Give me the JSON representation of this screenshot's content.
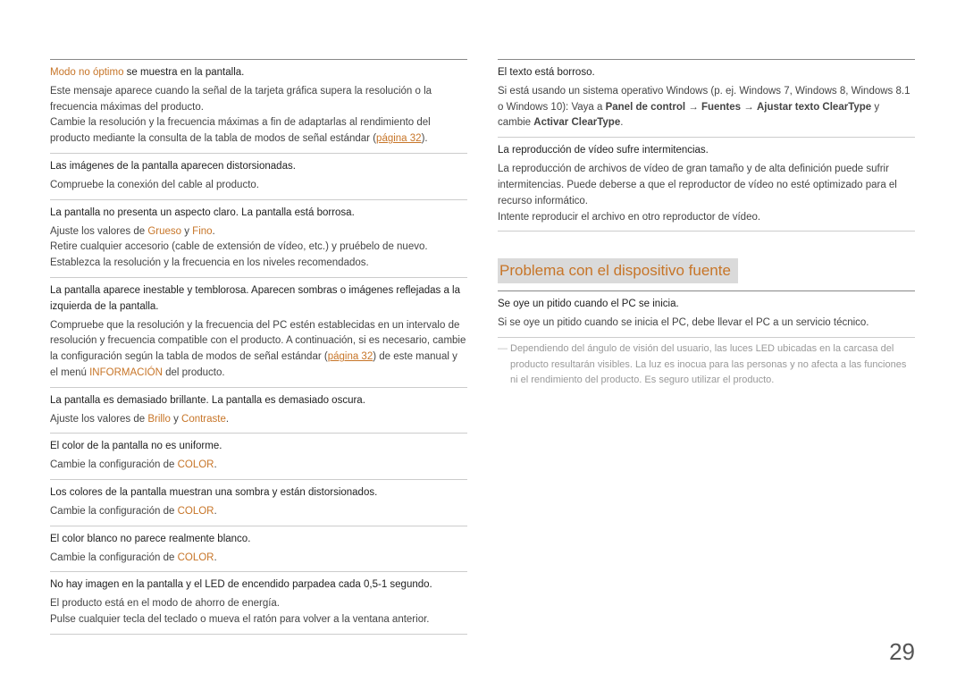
{
  "left": [
    {
      "q_pre": "Modo no óptimo",
      "q_post": " se muestra en la pantalla.",
      "a": "Este mensaje aparece cuando la señal de la tarjeta gráfica supera la resolución o la frecuencia máximas del producto.",
      "a2_pre": "Cambie la resolución y la frecuencia máximas a fin de adaptarlas al rendimiento del producto mediante la consulta de la tabla de modos de señal estándar (",
      "a2_link": "página 32",
      "a2_post": ")."
    },
    {
      "q": "Las imágenes de la pantalla aparecen distorsionadas.",
      "a": "Compruebe la conexión del cable al producto."
    },
    {
      "q": "La pantalla no presenta un aspecto claro. La pantalla está borrosa.",
      "a_pre": "Ajuste los valores de ",
      "a_o1": "Grueso",
      "a_mid": " y ",
      "a_o2": "Fino",
      "a_post": ".",
      "a2": "Retire cualquier accesorio (cable de extensión de vídeo, etc.) y pruébelo de nuevo.",
      "a3": "Establezca la resolución y la frecuencia en los niveles recomendados."
    },
    {
      "q": "La pantalla aparece inestable y temblorosa. Aparecen sombras o imágenes reflejadas a la izquierda de la pantalla.",
      "a_pre": "Compruebe que la resolución y la frecuencia del PC estén establecidas en un intervalo de resolución y frecuencia compatible con el producto. A continuación, si es necesario, cambie la configuración según la tabla de modos de señal estándar (",
      "a_link": "página 32",
      "a_mid": ") de este manual y el menú ",
      "a_o": "INFORMACIÓN",
      "a_post": " del producto."
    },
    {
      "q": "La pantalla es demasiado brillante. La pantalla es demasiado oscura.",
      "a_pre": "Ajuste los valores de ",
      "a_o1": "Brillo",
      "a_mid": " y ",
      "a_o2": "Contraste",
      "a_post": "."
    },
    {
      "q": "El color de la pantalla no es uniforme.",
      "a_pre": "Cambie la configuración de ",
      "a_o": "COLOR",
      "a_post": "."
    },
    {
      "q": "Los colores de la pantalla muestran una sombra y están distorsionados.",
      "a_pre": "Cambie la configuración de ",
      "a_o": "COLOR",
      "a_post": "."
    },
    {
      "q": "El color blanco no parece realmente blanco.",
      "a_pre": "Cambie la configuración de ",
      "a_o": "COLOR",
      "a_post": "."
    },
    {
      "q": "No hay imagen en la pantalla y el LED de encendido parpadea cada 0,5-1 segundo.",
      "a": "El producto está en el modo de ahorro de energía.",
      "a2": "Pulse cualquier tecla del teclado o mueva el ratón para volver a la ventana anterior."
    }
  ],
  "right_top": [
    {
      "q": "El texto está borroso.",
      "a_pre": "Si está usando un sistema operativo Windows (p. ej. Windows 7, Windows 8, Windows 8.1 o Windows 10): Vaya a ",
      "b1": "Panel de control",
      "ar1": " → ",
      "b2": "Fuentes",
      "ar2": " → ",
      "b3": "Ajustar texto ClearType",
      "mid": " y cambie ",
      "b4": "Activar ClearType",
      "post": "."
    },
    {
      "q": "La reproducción de vídeo sufre intermitencias.",
      "a": "La reproducción de archivos de vídeo de gran tamaño y de alta definición puede sufrir intermitencias. Puede deberse a que el reproductor de vídeo no esté optimizado para el recurso informático.",
      "a2": "Intente reproducir el archivo en otro reproductor de vídeo."
    }
  ],
  "section_title": "Problema con el dispositivo fuente",
  "right_bottom": [
    {
      "q": "Se oye un pitido cuando el PC se inicia.",
      "a": "Si se oye un pitido cuando se inicia el PC, debe llevar el PC a un servicio técnico."
    }
  ],
  "note": "Dependiendo del ángulo de visión del usuario, las luces LED ubicadas en la carcasa del producto resultarán visibles. La luz es inocua para las personas y no afecta a las funciones ni el rendimiento del producto. Es seguro utilizar el producto.",
  "page": "29"
}
